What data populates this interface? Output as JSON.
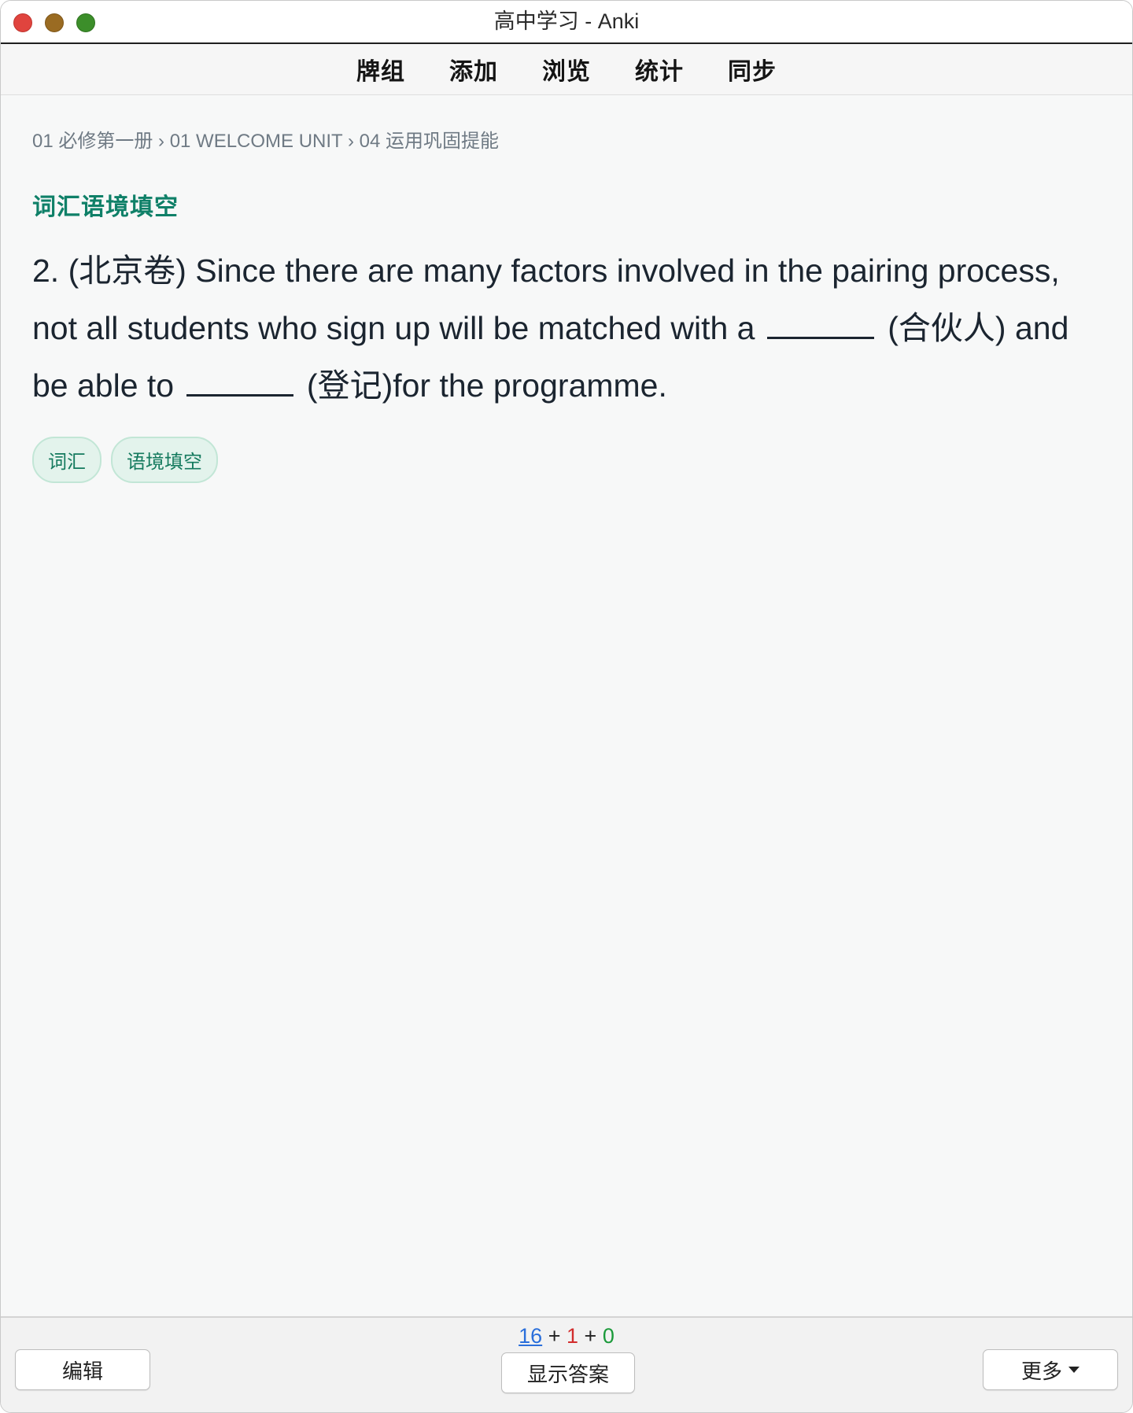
{
  "window": {
    "title": "高中学习 - Anki"
  },
  "toolbar": {
    "items": [
      "牌组",
      "添加",
      "浏览",
      "统计",
      "同步"
    ]
  },
  "card": {
    "breadcrumb": "01 必修第一册 › 01 WELCOME UNIT › 04 运用巩固提能",
    "section_title": "词汇语境填空",
    "question": {
      "part1": "2.  (北京卷) Since there are many factors involved in the pairing process, not all students who sign up will be matched with a",
      "part2": "(合伙人) and be able to",
      "part3": "(登记)for the programme."
    },
    "tags": [
      "词汇",
      "语境填空"
    ]
  },
  "bottom": {
    "edit_label": "编辑",
    "show_answer_label": "显示答案",
    "more_label": "更多",
    "counts": {
      "new": "16",
      "learn": "1",
      "review": "0",
      "sep": "+"
    }
  },
  "colors": {
    "section_title": "#0f8068",
    "new_count": "#2a6fdb",
    "learn_count": "#d22d2d",
    "review_count": "#1b9a3a"
  }
}
